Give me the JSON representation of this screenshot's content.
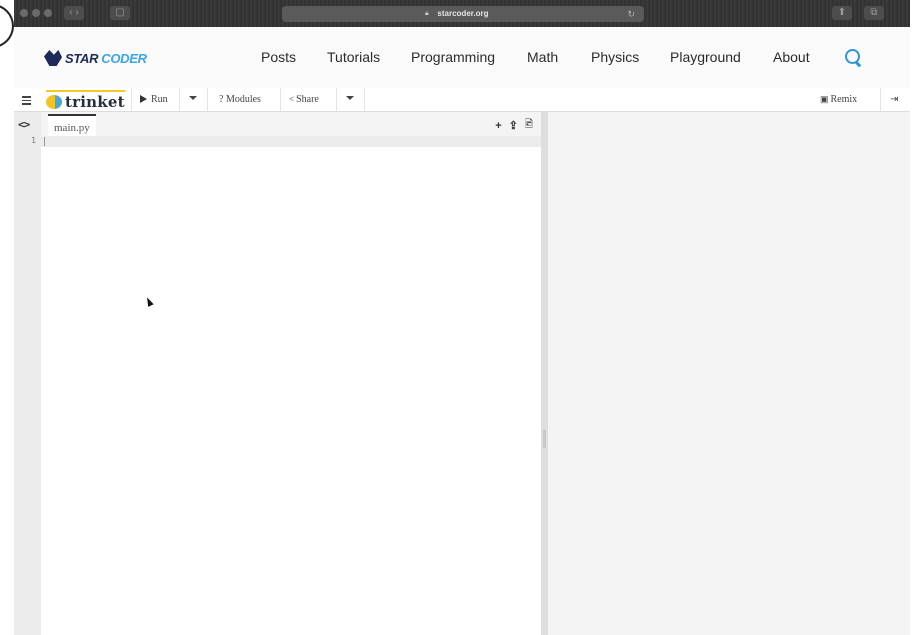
{
  "browser": {
    "url": "starcoder.org"
  },
  "site_nav": {
    "logo_star": "STAR",
    "logo_coder": "CODER",
    "links": [
      "Posts",
      "Tutorials",
      "Programming",
      "Math",
      "Physics",
      "Playground",
      "About"
    ]
  },
  "toolbar": {
    "brand": "trinket",
    "run": "Run",
    "modules": "? Modules",
    "share": "Share",
    "remix": "Remix"
  },
  "editor": {
    "code_nav": "<>",
    "file_tab": "main.py",
    "line_numbers": [
      "1"
    ],
    "tools": [
      "+",
      "upload-icon",
      "image-icon"
    ]
  },
  "colors": {
    "accent_blue": "#2e95d8",
    "brand_yellow": "#f3c928",
    "chrome_dark": "#333333"
  }
}
